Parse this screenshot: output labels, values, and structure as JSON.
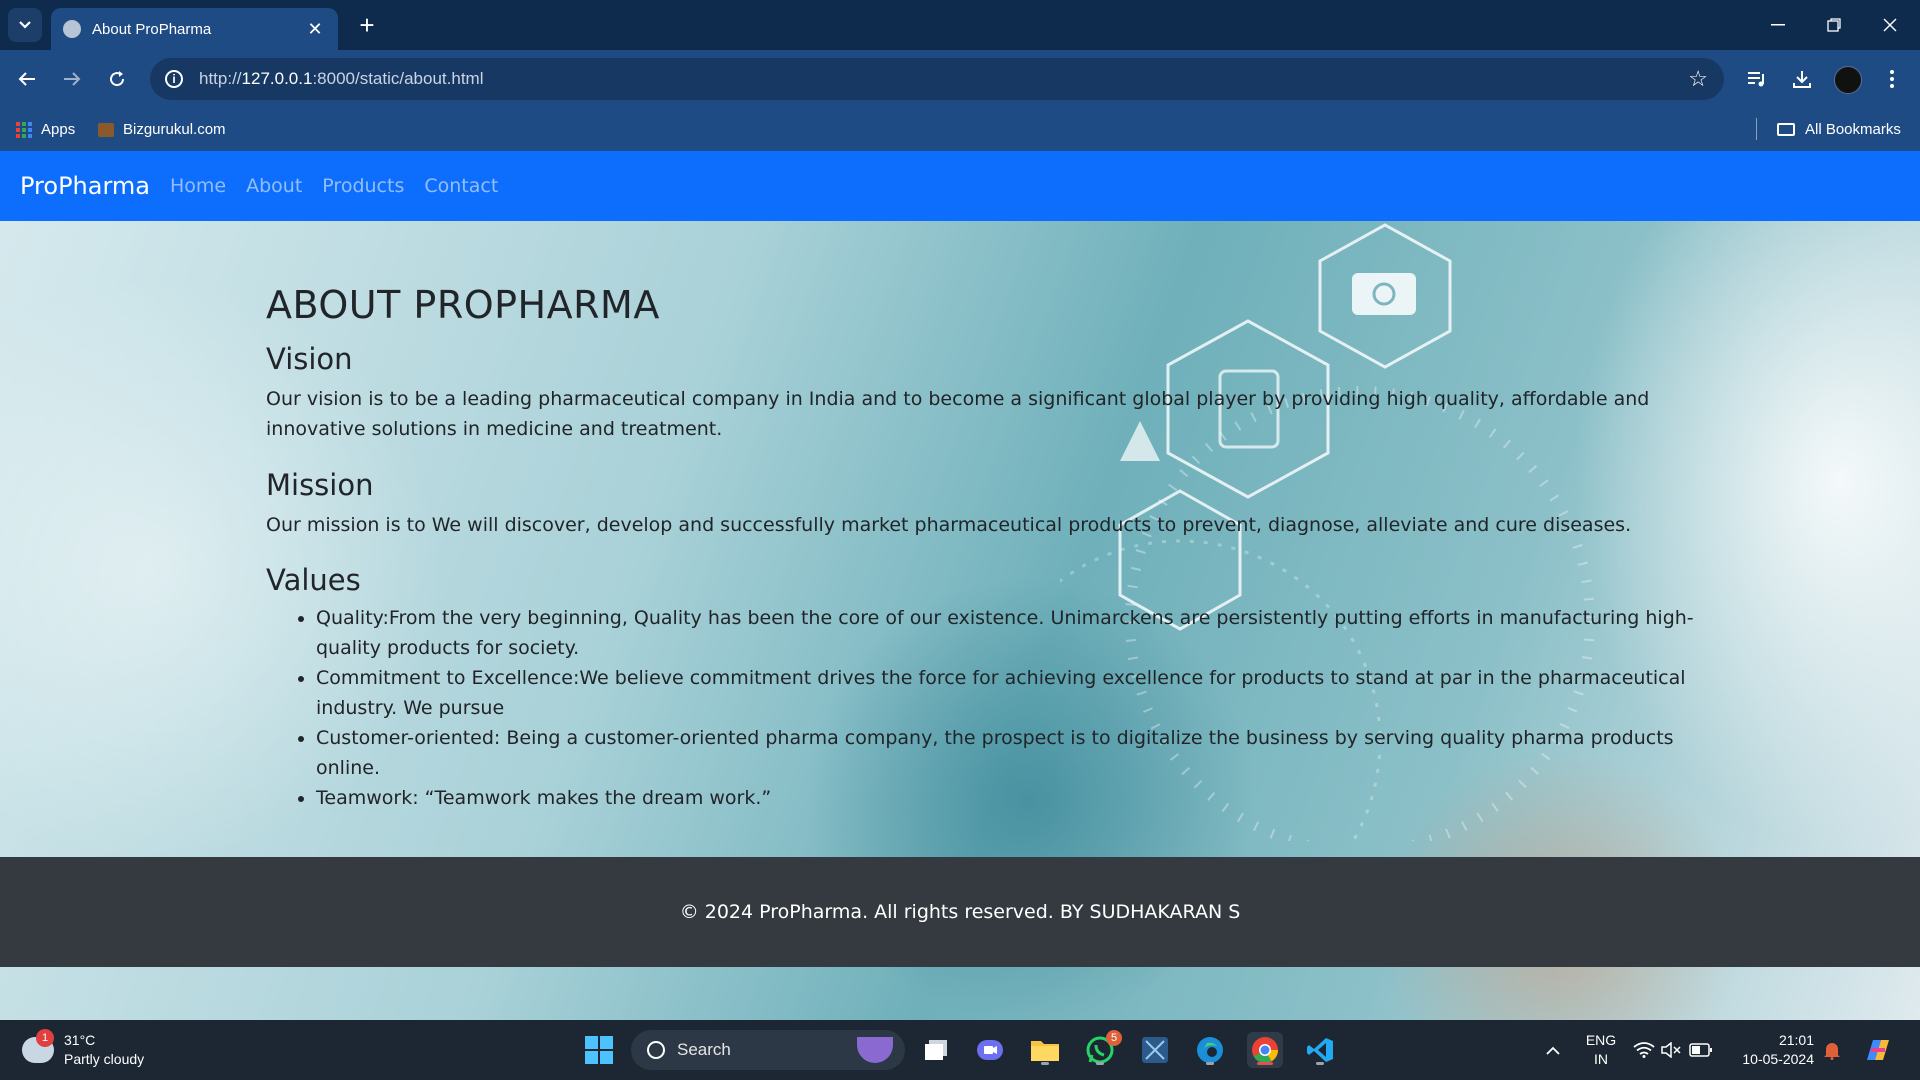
{
  "browser": {
    "tab_title": "About ProPharma",
    "url_prefix": "http://",
    "url_host": "127.0.0.1",
    "url_rest": ":8000/static/about.html",
    "bookmarks": [
      "Apps",
      "Bizgurukul.com"
    ],
    "all_bookmarks": "All Bookmarks"
  },
  "navbar": {
    "brand": "ProPharma",
    "links": [
      "Home",
      "About",
      "Products",
      "Contact"
    ]
  },
  "content": {
    "heading": "ABOUT PROPHARMA",
    "vision_heading": "Vision",
    "vision_text": "Our vision is to be a leading pharmaceutical company in India and to become a significant global player by providing high quality, affordable and innovative solutions in medicine and treatment.",
    "mission_heading": "Mission",
    "mission_text": "Our mission is to We will discover, develop and successfully market pharmaceutical products to prevent, diagnose, alleviate and cure diseases.",
    "values_heading": "Values",
    "values": [
      "Quality:From the very beginning, Quality has been the core of our existence. Unimarckens are persistently putting efforts in manufacturing high-quality products for society.",
      "Commitment to Excellence:We believe commitment drives the force for achieving excellence for products to stand at par in the pharmaceutical industry. We pursue",
      "Customer-oriented: Being a customer-oriented pharma company, the prospect is to digitalize the business by serving quality pharma products online.",
      "Teamwork: “Teamwork makes the dream work.”"
    ]
  },
  "footer": {
    "text": "© 2024 ProPharma. All rights reserved. BY SUDHAKARAN S"
  },
  "taskbar": {
    "weather_temp": "31°C",
    "weather_desc": "Partly cloudy",
    "weather_badge": "1",
    "search_placeholder": "Search",
    "whatsapp_badge": "5",
    "lang_line1": "ENG",
    "lang_line2": "IN",
    "time": "21:01",
    "date": "10-05-2024"
  },
  "colors": {
    "navbar_bg": "#0d6efd",
    "footer_bg": "#343a40",
    "chrome_bg": "#1f4b85"
  }
}
